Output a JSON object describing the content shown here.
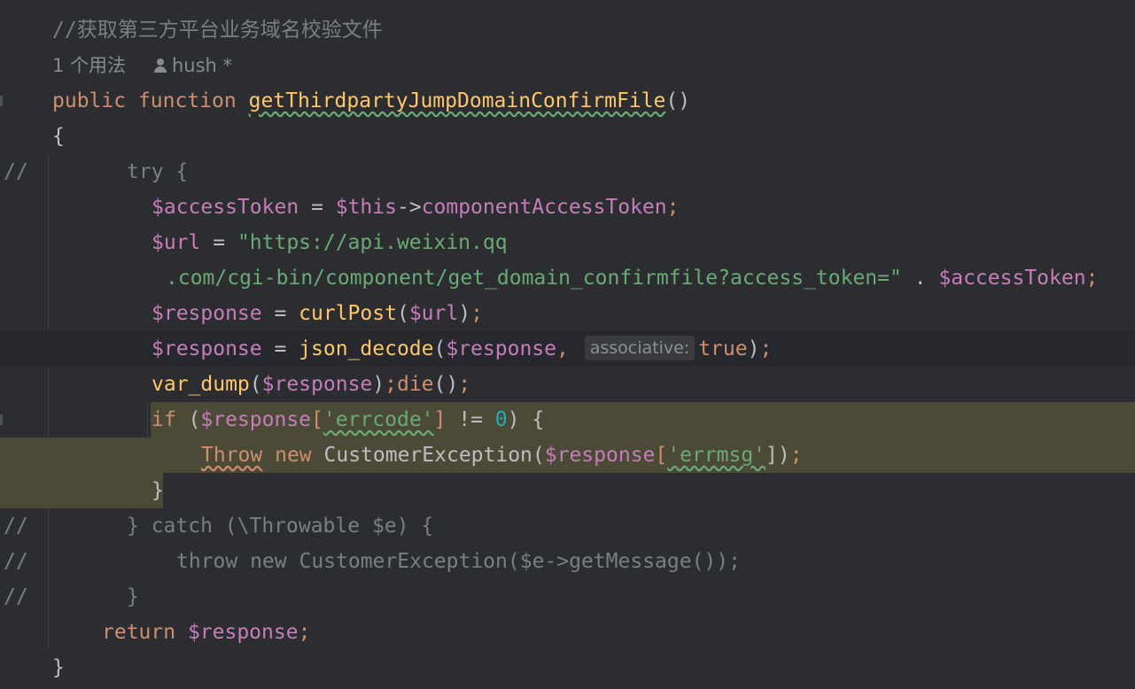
{
  "editor": {
    "doc_comment": "//获取第三方平台业务域名校验文件",
    "usage_count": "1 个用法",
    "author": "hush *",
    "gutter_comment": "//"
  },
  "line_signature": {
    "public": "public",
    "function": "function",
    "name": "getThirdpartyJumpDomainConfirmFile",
    "parens": "()"
  },
  "line_open_brace": "{",
  "line_try": "try {",
  "line_access": {
    "var": "$accessToken",
    "eq": " = ",
    "this": "$this",
    "arrow": "->",
    "prop": "componentAccessToken",
    "semi": ";"
  },
  "line_url1": {
    "var": "$url",
    "eq": " = ",
    "str": "\"https://api.weixin.qq"
  },
  "line_url2": {
    "str": ".com/cgi-bin/component/get_domain_confirmfile?access_token=\"",
    "dot": " . ",
    "var": "$accessToken",
    "semi": ";"
  },
  "line_curl": {
    "var": "$response",
    "eq": " = ",
    "fn": "curlPost",
    "lp": "(",
    "arg": "$url",
    "rp": ")",
    "semi": ";"
  },
  "line_decode": {
    "var": "$response",
    "eq": " = ",
    "fn": "json_decode",
    "lp": "(",
    "arg": "$response",
    "comma": ",",
    "hint": "associative:",
    "val": "true",
    "rp": ")",
    "semi": ";"
  },
  "line_dump": {
    "fn": "var_dump",
    "lp": "(",
    "arg": "$response",
    "rp": ")",
    "semi": ";",
    "die": "die",
    "die_parens": "()",
    "semi2": ";"
  },
  "line_if": {
    "kw": "if",
    "lp": " (",
    "var": "$response",
    "lb": "[",
    "key": "'errcode'",
    "rb": "]",
    "op": " != ",
    "num": "0",
    "rest": ") {"
  },
  "line_throw": {
    "kw": "Throw",
    "new": " new ",
    "cls": "CustomerException",
    "lp": "(",
    "var": "$response",
    "lb": "[",
    "key": "'errmsg'",
    "rest": "])",
    "semi": ";"
  },
  "line_close_if": "}",
  "line_catch": "} catch (\\Throwable $e) {",
  "line_rethrow": "throw new CustomerException($e->getMessage());",
  "line_close_catch": "}",
  "line_return": {
    "kw": "return",
    "var": " $response",
    "semi": ";"
  },
  "line_close_fn": "}"
}
